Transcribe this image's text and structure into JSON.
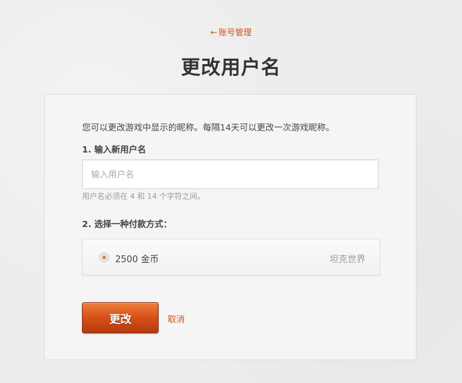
{
  "header": {
    "back_arrow": "←",
    "back_label": "账号管理",
    "title": "更改用户名"
  },
  "form": {
    "intro": "您可以更改游戏中显示的昵称。每隔14天可以更改一次游戏昵称。",
    "step1_label": "1. 输入新用户名",
    "name_input": {
      "value": "",
      "placeholder": "输入用户名"
    },
    "name_hint": "用户名必须在 4 和 14 个字符之间。",
    "step2_label": "2. 选择一种付款方式：",
    "payment_option": {
      "price": "2500 金币",
      "game": "坦克世界",
      "selected": true
    },
    "submit_label": "更改",
    "cancel_label": "取消"
  },
  "colors": {
    "accent": "#d2541a",
    "button_top": "#f0803c",
    "button_bottom": "#b53a0c"
  }
}
